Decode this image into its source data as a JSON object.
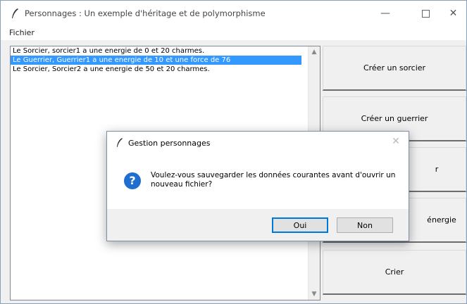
{
  "window": {
    "title": "Personnages : Un exemple d'héritage et de polymorphisme",
    "controls": {
      "minimize": "—",
      "close": "✕"
    }
  },
  "menu": {
    "file": "Fichier"
  },
  "list": {
    "items": [
      {
        "text": "Le Sorcier, sorcier1 a une energie de 0 et 20 charmes.",
        "selected": false
      },
      {
        "text": "Le Guerrier, Guerrier1 a une energie de 10 et une force de 76",
        "selected": true
      },
      {
        "text": "Le Sorcier, Sorcier2 a une energie de 50 et 20 charmes.",
        "selected": false
      }
    ],
    "scroll_up_icon": "▲",
    "scroll_down_icon": "▼"
  },
  "buttons": {
    "create_wizard": "Créer un sorcier",
    "create_warrior": "Créer un guerrier",
    "button3_visible": "r",
    "button4_visible": "énergie",
    "shout": "Crier"
  },
  "dialog": {
    "title": "Gestion personnages",
    "close": "✕",
    "icon": "?",
    "message": "Voulez-vous sauvegarder les données courantes avant d'ouvrir un nouveau fichier?",
    "yes": "Oui",
    "no": "Non"
  },
  "colors": {
    "selection": "#3399ff",
    "dialog_icon": "#1f6fd1",
    "default_button_border": "#0078d7"
  }
}
